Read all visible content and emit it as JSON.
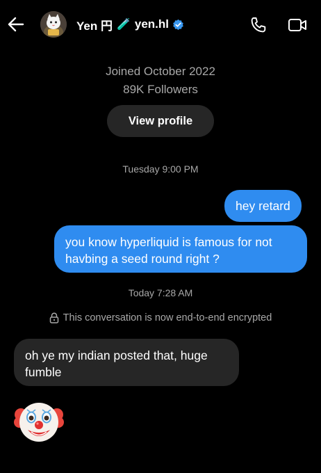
{
  "header": {
    "display_name": "Yen 円",
    "title_emoji": "🧪",
    "username": "yen.hl",
    "icons": [
      "back-arrow-icon",
      "avatar",
      "verified-badge-icon",
      "phone-icon",
      "video-camera-icon"
    ]
  },
  "profile": {
    "joined": "Joined October 2022",
    "followers": "89K Followers",
    "view_profile_label": "View profile"
  },
  "conversation": {
    "timestamp_1": "Tuesday 9:00 PM",
    "messages_out": [
      {
        "text": "hey retard"
      },
      {
        "text": "you know hyperliquid is famous for not havbing a seed round right ?"
      }
    ],
    "timestamp_2": "Today 7:28 AM",
    "encrypted_notice": "This conversation is now end-to-end encrypted",
    "messages_in": [
      {
        "text": "oh ye my indian posted that, huge fumble"
      }
    ],
    "reaction_emoji_icon": "clown-face-emoji"
  },
  "colors": {
    "background": "#000000",
    "outgoing_bubble": "#2f8cf0",
    "incoming_bubble": "#262626",
    "button_bg": "#262626",
    "muted_text": "#a8a8a8",
    "verified": "#3897f0"
  }
}
